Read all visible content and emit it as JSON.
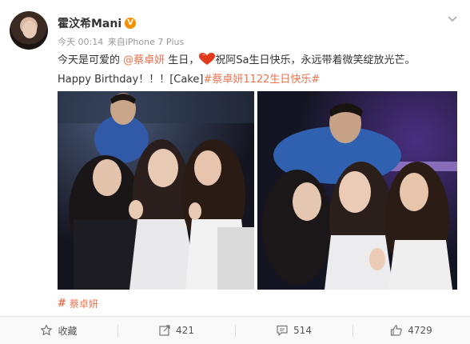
{
  "post": {
    "username": "霍汶希Mani",
    "verified_badge": "V",
    "time": "今天 00:14",
    "source": "来自iPhone 7 Plus",
    "text_line1_a": "今天是可爱的 ",
    "mention": "@蔡卓妍",
    "text_line1_b": " 生日，",
    "text_line1_c": "祝阿Sa生日快乐，永远带着微笑绽放光芒。",
    "text_line2_a": "Happy Birthday！！！[Cake]",
    "hashtag": "#蔡卓妍1122生日快乐#",
    "topic_hash": "#",
    "topic_name": "蔡卓妍"
  },
  "actions": {
    "favorite_label": "收藏",
    "repost_count": "421",
    "comment_count": "514",
    "like_count": "4729"
  },
  "icons": {
    "heart": "heart-icon",
    "chevron": "chevron-down-icon",
    "star": "star-icon",
    "repost": "repost-icon",
    "comment": "comment-icon",
    "like": "thumbs-up-icon"
  },
  "colors": {
    "link": "#eb7350",
    "badge": "#f29000",
    "heart": "#e0391b"
  }
}
